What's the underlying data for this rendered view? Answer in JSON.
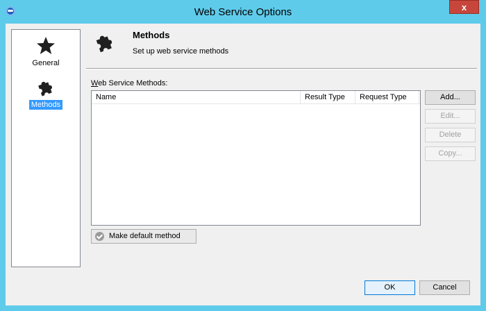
{
  "window": {
    "title": "Web Service Options",
    "close_label": "x"
  },
  "sidebar": {
    "items": [
      {
        "label": "General",
        "icon": "star-icon",
        "selected": false
      },
      {
        "label": "Methods",
        "icon": "puzzle-icon",
        "selected": true
      }
    ]
  },
  "header": {
    "title": "Methods",
    "subtitle": "Set up web service methods",
    "icon": "puzzle-icon"
  },
  "methods_list": {
    "label_first": "W",
    "label_rest": "eb Service Methods:",
    "columns": [
      "Name",
      "Result Type",
      "Request Type"
    ],
    "rows": []
  },
  "side_buttons": {
    "add": "Add...",
    "edit": "Edit...",
    "delete": "Delete",
    "copy": "Copy..."
  },
  "make_default": {
    "label": "Make default method"
  },
  "footer": {
    "ok": "OK",
    "cancel": "Cancel"
  },
  "colors": {
    "frame": "#5fcbea",
    "selection": "#3399ff",
    "close": "#c7463c"
  }
}
